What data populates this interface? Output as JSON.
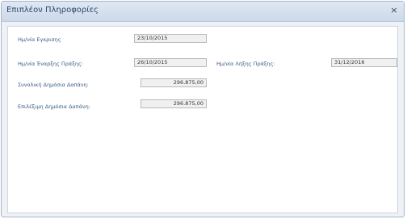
{
  "dialog": {
    "title": "Επιπλέον Πληροφορίες",
    "close_glyph": "×",
    "close_icon": "close-icon"
  },
  "fields": {
    "approval_date": {
      "label": "Ημ/νία Εγκρισης",
      "value": "23/10/2015"
    },
    "start_date": {
      "label": "Ημ/νία Έναρξης Πράξης:",
      "value": "26/10/2015"
    },
    "end_date": {
      "label": "Ημ/νία Λήξης Πράξης:",
      "value": "31/12/2016"
    },
    "total_public_expenditure": {
      "label": "Συνολική Δημόσια Δαπάνη:",
      "value": "296.875,00"
    },
    "eligible_public_expenditure": {
      "label": "Επιλέξιμη Δημόσια Δαπάνη:",
      "value": "296.875,00"
    }
  }
}
